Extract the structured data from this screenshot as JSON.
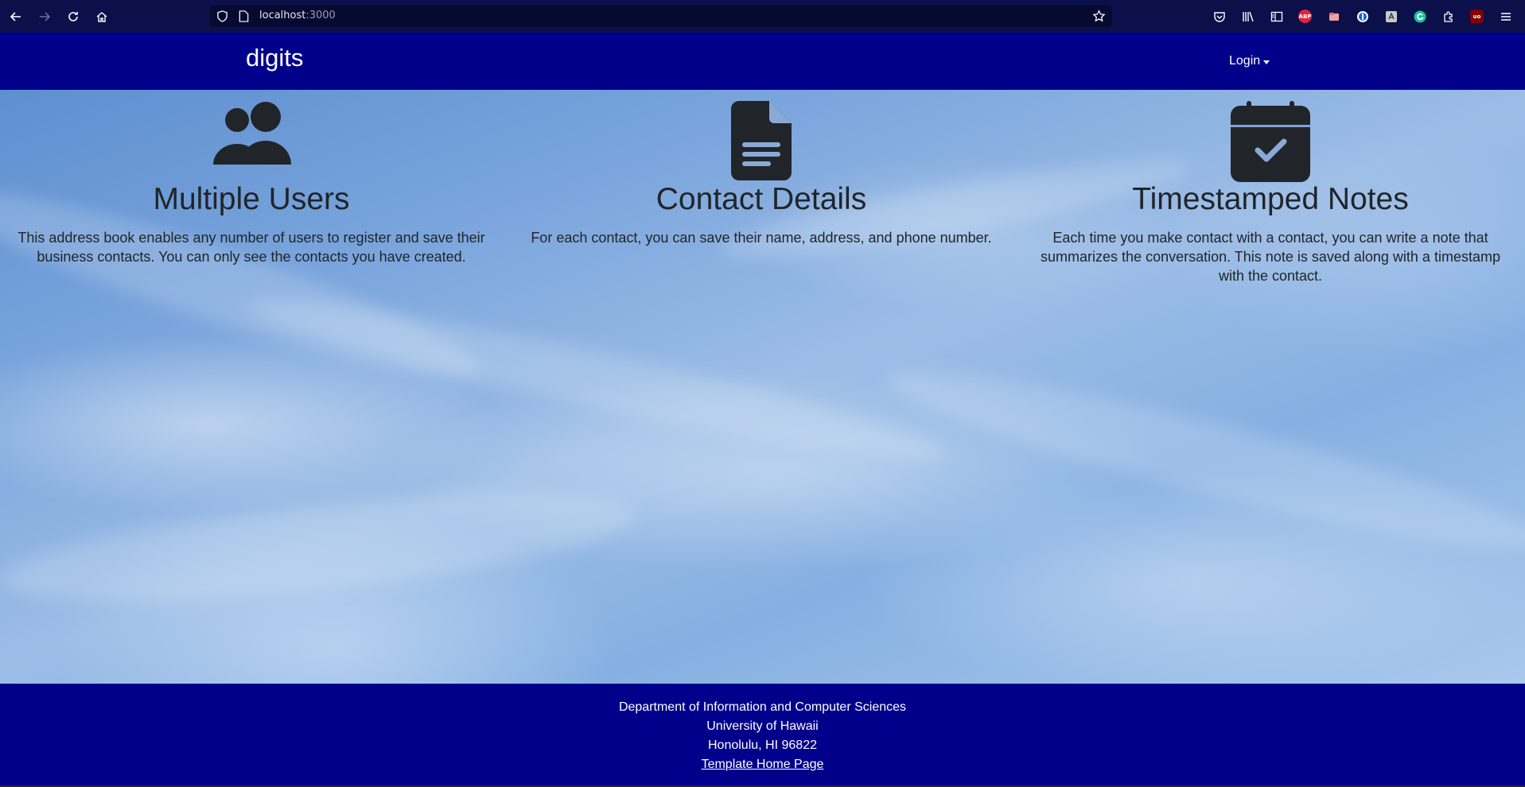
{
  "browser": {
    "url_host": "localhost",
    "url_port": ":3000",
    "extensions": {
      "abp_label": "ABP",
      "ub_label": "uo"
    }
  },
  "navbar": {
    "brand": "digits",
    "login_label": "Login"
  },
  "features": [
    {
      "icon": "users-icon",
      "title": "Multiple Users",
      "text": "This address book enables any number of users to register and save their business contacts. You can only see the contacts you have created."
    },
    {
      "icon": "file-icon",
      "title": "Contact Details",
      "text": "For each contact, you can save their name, address, and phone number."
    },
    {
      "icon": "calendar-check-icon",
      "title": "Timestamped Notes",
      "text": "Each time you make contact with a contact, you can write a note that summarizes the conversation. This note is saved along with a timestamp with the contact."
    }
  ],
  "footer": {
    "line1": "Department of Information and Computer Sciences",
    "line2": "University of Hawaii",
    "line3": "Honolulu, HI 96822",
    "link_label": "Template Home Page"
  },
  "colors": {
    "navbar_bg": "#00008b",
    "footer_bg": "#00008b",
    "icon_color": "#212529"
  }
}
